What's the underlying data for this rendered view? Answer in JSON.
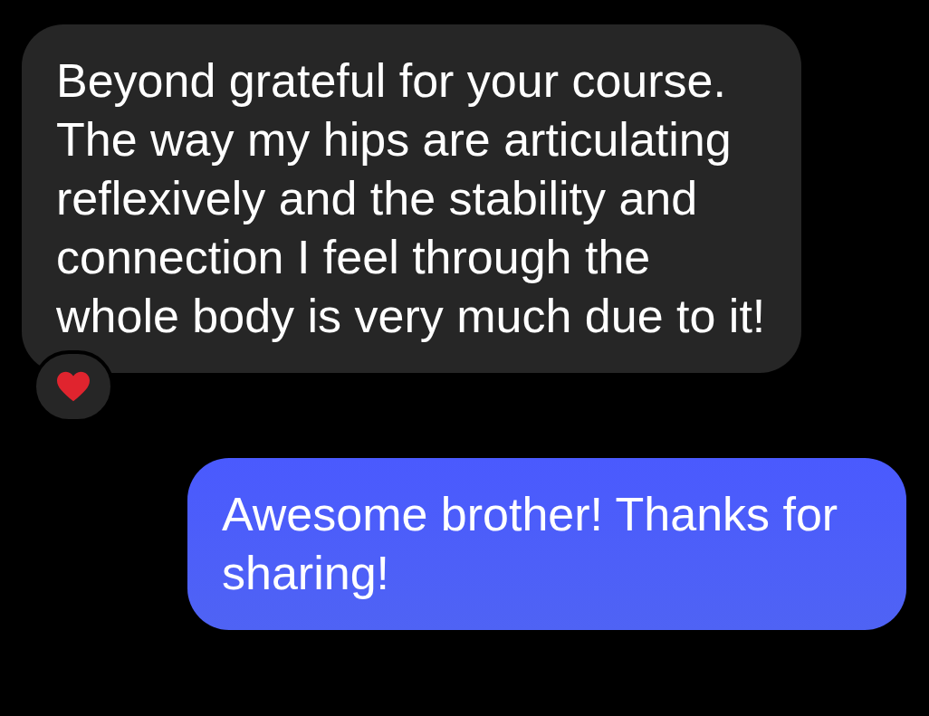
{
  "messages": [
    {
      "kind": "received",
      "text": "Beyond grateful for your course. The way my hips are articulating reflexively and the stability and connection I feel through the whole body is very much due to it!",
      "reacted": true
    },
    {
      "kind": "sent",
      "text": "Awesome brother! Thanks for sharing!"
    }
  ]
}
